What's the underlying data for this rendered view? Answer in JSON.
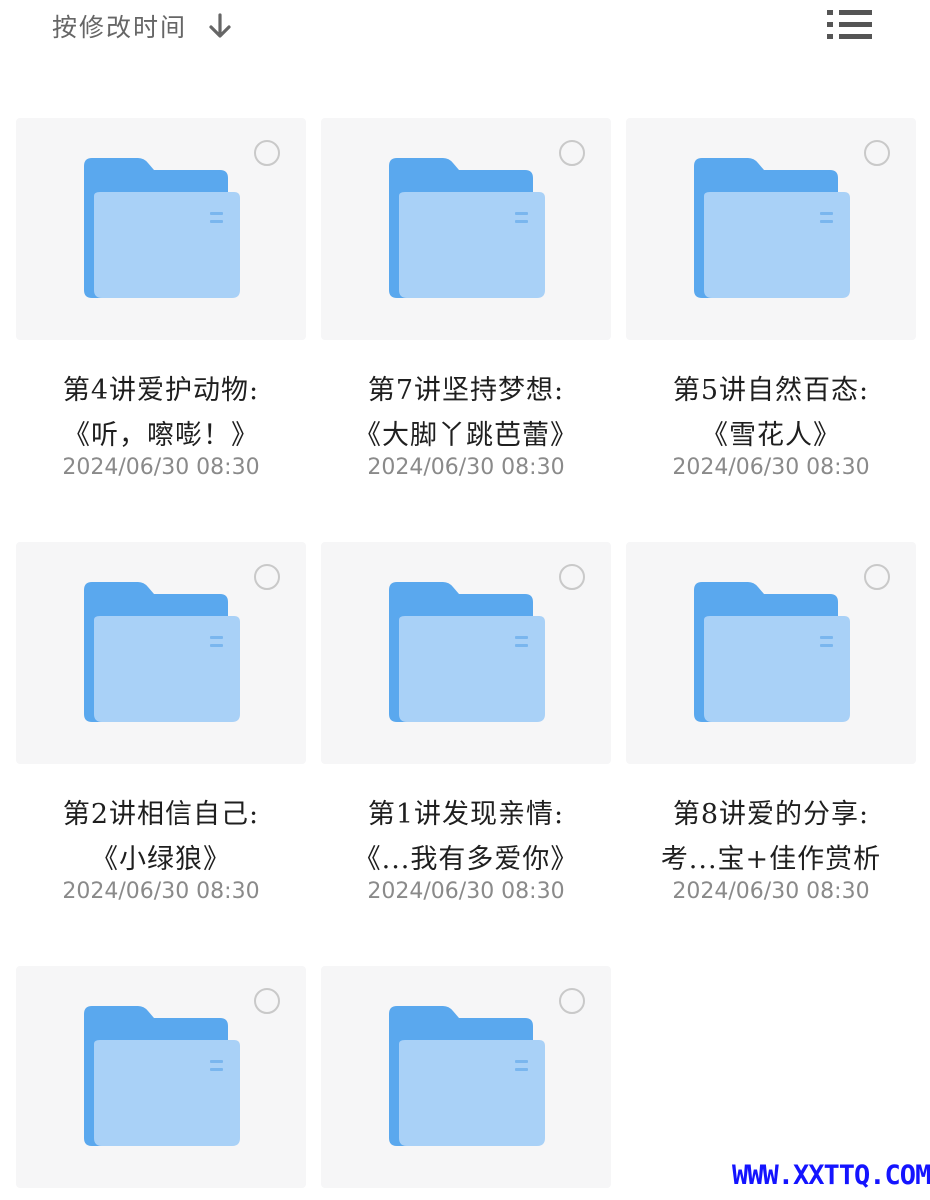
{
  "toolbar": {
    "sort_label": "按修改时间",
    "sort_icon": "arrow-down-icon",
    "view_icon": "list-view-icon"
  },
  "colors": {
    "folder_back": "#5aa8ee",
    "folder_front": "#a9d1f7",
    "thumb_bg": "#f6f6f7",
    "watermark": "#1414ff"
  },
  "items": [
    {
      "line1": "第4讲爱护动物:",
      "line2": "《听，嚓嘭！》",
      "date": "2024/06/30 08:30"
    },
    {
      "line1": "第7讲坚持梦想:",
      "line2": "《大脚丫跳芭蕾》",
      "date": "2024/06/30 08:30"
    },
    {
      "line1": "第5讲自然百态:",
      "line2": "《雪花人》",
      "date": "2024/06/30 08:30"
    },
    {
      "line1": "第2讲相信自己:",
      "line2": "《小绿狼》",
      "date": "2024/06/30 08:30"
    },
    {
      "line1": "第1讲发现亲情:",
      "line2": "《...我有多爱你》",
      "date": "2024/06/30 08:30"
    },
    {
      "line1": "第8讲爱的分享:",
      "line2": "考...宝+佳作赏析",
      "date": "2024/06/30 08:30"
    },
    {
      "line1": "",
      "line2": "",
      "date": ""
    },
    {
      "line1": "",
      "line2": "",
      "date": ""
    }
  ],
  "watermark": "WWW.XXTTQ.COM"
}
